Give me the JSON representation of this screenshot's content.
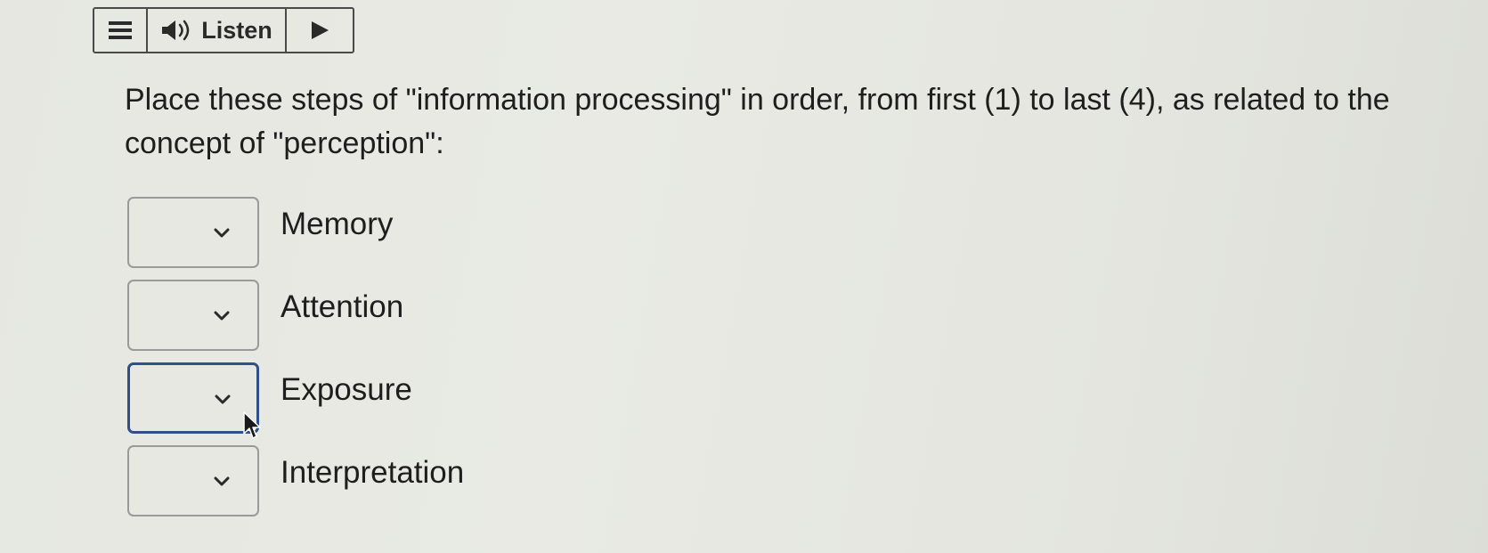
{
  "toolbar": {
    "menu_icon": "hamburger-menu-icon",
    "speaker_icon": "speaker-icon",
    "listen_label": "Listen",
    "play_icon": "play-icon"
  },
  "question": {
    "text": "Place these steps of \"information processing\" in order, from first (1) to last (4), as related to the concept of \"perception\":"
  },
  "items": [
    {
      "label": "Memory",
      "selected": ""
    },
    {
      "label": "Attention",
      "selected": ""
    },
    {
      "label": "Exposure",
      "selected": "",
      "focused": true
    },
    {
      "label": "Interpretation",
      "selected": ""
    }
  ],
  "colors": {
    "focus_border": "#2f4e8a",
    "default_border": "#9a9a9a",
    "background": "#e7e8e2"
  }
}
